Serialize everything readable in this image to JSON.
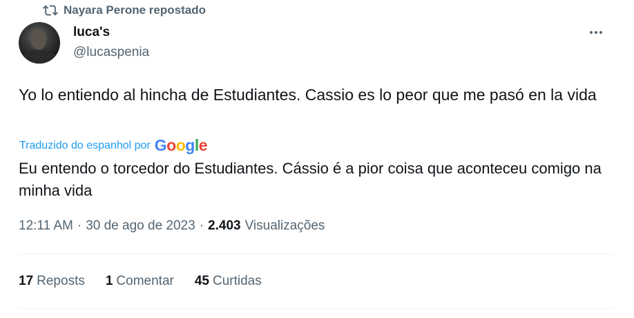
{
  "repost": {
    "icon": "repost-icon",
    "text": "Nayara Perone repostado"
  },
  "author": {
    "name": "luca's",
    "handle": "@lucaspenia",
    "avatar_icon": "user-avatar"
  },
  "more_icon": "ellipsis-icon",
  "tweet": {
    "text": "Yo lo entiendo al hincha de Estudiantes. Cassio es lo peor que me pasó en la vida"
  },
  "translation": {
    "label": "Traduzido do espanhol por",
    "provider": "Google",
    "text": "Eu entendo o torcedor do Estudiantes. Cássio é a pior coisa que aconteceu comigo na minha vida"
  },
  "meta": {
    "time": "12:11 AM",
    "separator": "·",
    "date": "30 de ago de 2023",
    "views_count": "2.403",
    "views_label": "Visualizações"
  },
  "stats": {
    "reposts_count": "17",
    "reposts_label": "Reposts",
    "comments_count": "1",
    "comments_label": "Comentar",
    "likes_count": "45",
    "likes_label": "Curtidas"
  },
  "colors": {
    "text": "#0f1419",
    "secondary": "#536471",
    "link": "#1d9bf0",
    "divider": "#eff3f4",
    "google_blue": "#4285F4",
    "google_red": "#EA4335",
    "google_yellow": "#FBBC05",
    "google_green": "#34A853"
  }
}
